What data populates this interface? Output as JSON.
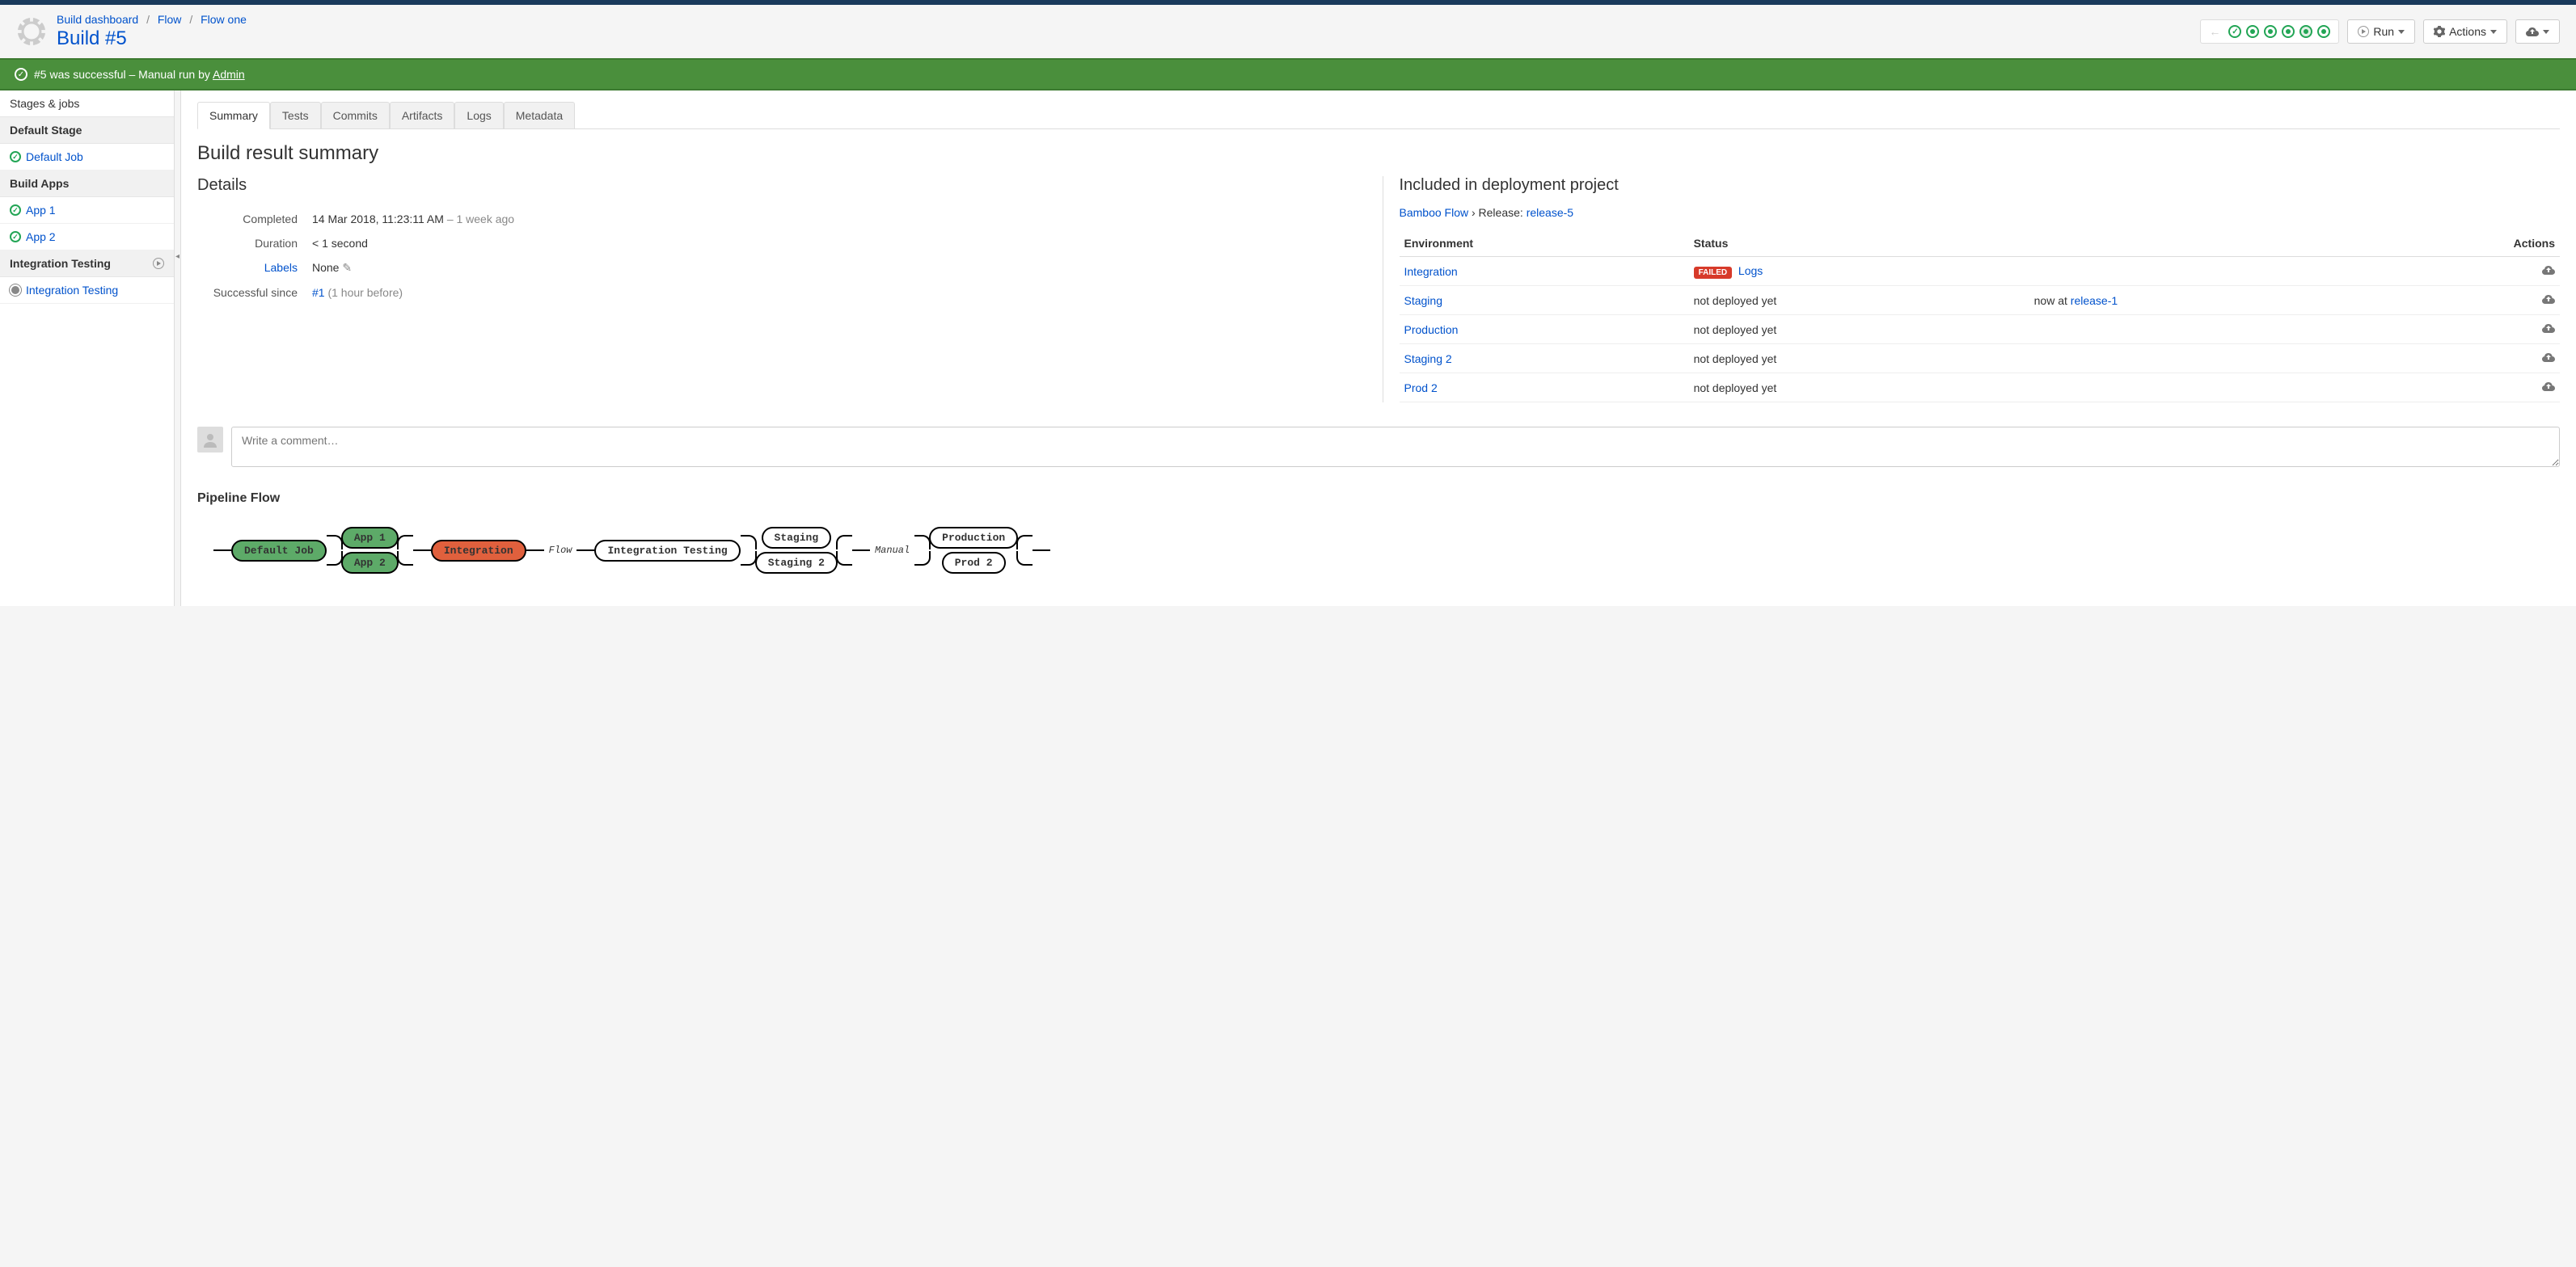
{
  "breadcrumb": {
    "items": [
      {
        "label": "Build dashboard"
      },
      {
        "label": "Flow"
      },
      {
        "label": "Flow one"
      }
    ]
  },
  "page_title": "Build #5",
  "banner": {
    "text_prefix": "#5 was successful – Manual run by ",
    "user": "Admin"
  },
  "header_buttons": {
    "run": "Run",
    "actions": "Actions"
  },
  "sidebar": {
    "title": "Stages & jobs",
    "groups": [
      {
        "name": "Default Stage",
        "items": [
          {
            "label": "Default Job",
            "status": "success"
          }
        ]
      },
      {
        "name": "Build Apps",
        "items": [
          {
            "label": "App 1",
            "status": "success"
          },
          {
            "label": "App 2",
            "status": "success"
          }
        ]
      },
      {
        "name": "Integration Testing",
        "manual": true,
        "items": [
          {
            "label": "Integration Testing",
            "status": "pending"
          }
        ]
      }
    ]
  },
  "tabs": [
    {
      "label": "Summary",
      "active": true
    },
    {
      "label": "Tests"
    },
    {
      "label": "Commits"
    },
    {
      "label": "Artifacts"
    },
    {
      "label": "Logs"
    },
    {
      "label": "Metadata"
    }
  ],
  "section_title": "Build result summary",
  "details": {
    "heading": "Details",
    "rows": {
      "completed_label": "Completed",
      "completed_value": "14 Mar 2018, 11:23:11 AM",
      "completed_rel": "– 1 week ago",
      "duration_label": "Duration",
      "duration_value": "< 1 second",
      "labels_label": "Labels",
      "labels_value": "None",
      "since_label": "Successful since",
      "since_link": "#1",
      "since_rel": "(1 hour before)"
    }
  },
  "deployment": {
    "heading": "Included in deployment project",
    "project_link": "Bamboo Flow",
    "release_prefix": " › Release: ",
    "release_link": "release-5",
    "columns": {
      "env": "Environment",
      "status": "Status",
      "actions": "Actions"
    },
    "rows": [
      {
        "env": "Integration",
        "status_badge": "FAILED",
        "logs": "Logs",
        "extra": ""
      },
      {
        "env": "Staging",
        "status_text": "not deployed yet",
        "extra_prefix": "now at ",
        "extra_link": "release-1"
      },
      {
        "env": "Production",
        "status_text": "not deployed yet"
      },
      {
        "env": "Staging 2",
        "status_text": "not deployed yet"
      },
      {
        "env": "Prod 2",
        "status_text": "not deployed yet"
      }
    ]
  },
  "comment_placeholder": "Write a comment…",
  "pipeline": {
    "heading": "Pipeline Flow",
    "nodes": {
      "default_job": "Default Job",
      "app1": "App 1",
      "app2": "App 2",
      "integration": "Integration",
      "flow_label": "Flow",
      "integration_testing": "Integration Testing",
      "staging": "Staging",
      "staging2": "Staging 2",
      "manual_label": "Manual",
      "production": "Production",
      "prod2": "Prod 2"
    }
  }
}
